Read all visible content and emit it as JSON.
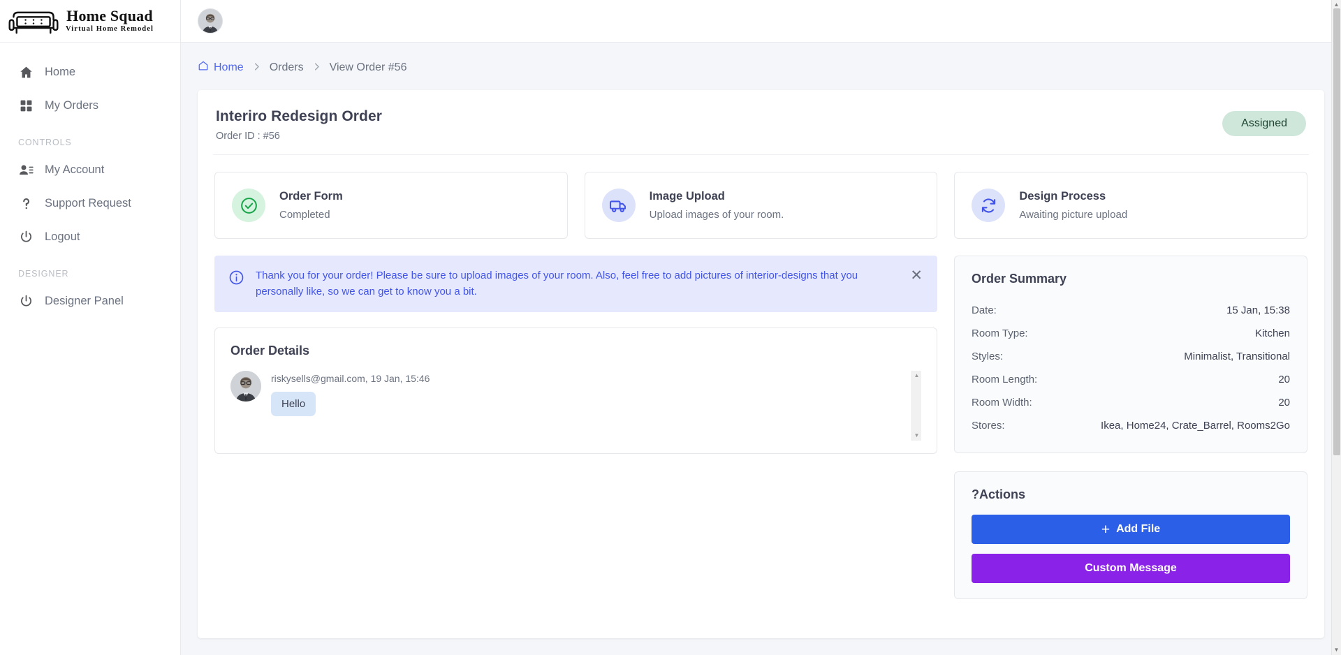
{
  "brand": {
    "title": "Home Squad",
    "subtitle": "Virtual Home Remodel",
    "logo_icon": "sofa-icon"
  },
  "sidebar": {
    "items": [
      {
        "label": "Home",
        "icon": "home-icon"
      },
      {
        "label": "My Orders",
        "icon": "grid-icon"
      }
    ],
    "sections": [
      {
        "label": "CONTROLS",
        "items": [
          {
            "label": "My Account",
            "icon": "user-list-icon"
          },
          {
            "label": "Support Request",
            "icon": "question-mark-icon"
          },
          {
            "label": "Logout",
            "icon": "power-icon"
          }
        ]
      },
      {
        "label": "DESIGNER",
        "items": [
          {
            "label": "Designer Panel",
            "icon": "power-icon"
          }
        ]
      }
    ]
  },
  "topbar": {
    "avatar_icon": "user-avatar"
  },
  "breadcrumb": {
    "home": "Home",
    "home_icon": "home-outline-icon",
    "separator": "›",
    "items": [
      "Orders",
      "View Order #56"
    ]
  },
  "order": {
    "title": "Interiro Redesign Order",
    "order_id_label": "Order ID : #56",
    "status": "Assigned",
    "status_bg": "#cfe6da",
    "status_color": "#1e4632"
  },
  "steps": [
    {
      "title": "Order Form",
      "desc": "Completed",
      "icon": "check-circle-icon",
      "tone": "green"
    },
    {
      "title": "Image Upload",
      "desc": "Upload images of your room.",
      "icon": "truck-icon",
      "tone": "blue"
    },
    {
      "title": "Design Process",
      "desc": "Awaiting picture upload",
      "icon": "refresh-sync-icon",
      "tone": "blue"
    }
  ],
  "alert": {
    "icon": "info-circle-icon",
    "text": "Thank you for your order! Please be sure to upload images of your room. Also, feel free to add pictures of interior-designs that you personally like, so we can get to know you a bit.",
    "close_icon": "close-icon",
    "close_label": "✕",
    "accent": "#4355e8",
    "background": "#e6e9fd"
  },
  "order_details": {
    "title": "Order Details",
    "messages": [
      {
        "meta": "riskysells@gmail.com, 19 Jan, 15:46",
        "text": "Hello"
      }
    ],
    "scroll_up": "▲",
    "scroll_down": "▼"
  },
  "summary": {
    "title": "Order Summary",
    "rows": [
      {
        "key": "Date:",
        "value": "15 Jan, 15:38"
      },
      {
        "key": "Room Type:",
        "value": "Kitchen"
      },
      {
        "key": "Styles:",
        "value": "Minimalist, Transitional"
      },
      {
        "key": "Room Length:",
        "value": "20"
      },
      {
        "key": "Room Width:",
        "value": "20"
      },
      {
        "key": "Stores:",
        "value": "Ikea, Home24, Crate_Barrel, Rooms2Go"
      }
    ]
  },
  "actions": {
    "title": "?Actions",
    "add_file": "Add File",
    "add_file_icon": "plus-icon",
    "add_file_color": "#2c5fe8",
    "custom_message": "Custom Message",
    "custom_message_color": "#8b22e8"
  },
  "page_scrollbar": {
    "up": "▲",
    "down": "▼"
  }
}
